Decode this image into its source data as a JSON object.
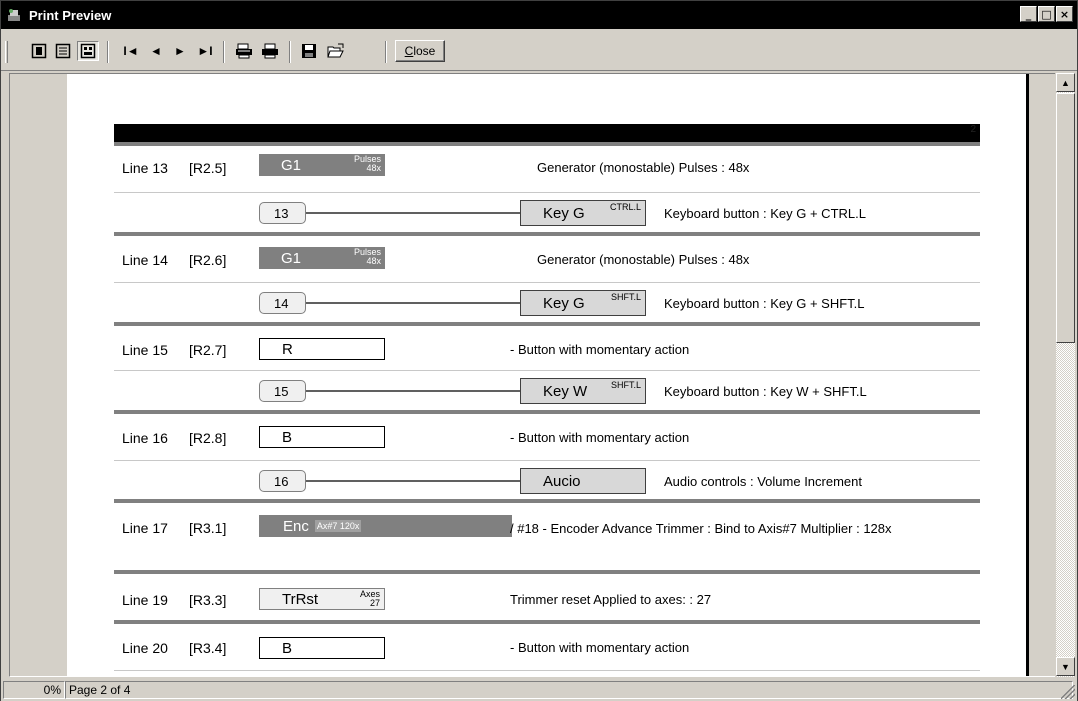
{
  "window": {
    "title": "Print Preview",
    "controls": [
      "_",
      "□",
      "×"
    ]
  },
  "toolbar": {
    "buttons": [
      {
        "name": "single-page-icon"
      },
      {
        "name": "two-page-icon"
      },
      {
        "name": "multi-page-icon"
      },
      {
        "name": "first-page-icon",
        "glyph": "I◄"
      },
      {
        "name": "prev-page-icon",
        "glyph": "◄"
      },
      {
        "name": "next-page-icon",
        "glyph": "►"
      },
      {
        "name": "last-page-icon",
        "glyph": "►I"
      },
      {
        "name": "print-setup-icon"
      },
      {
        "name": "print-icon"
      },
      {
        "name": "save-icon"
      },
      {
        "name": "open-icon"
      }
    ],
    "close_label_prefix": "",
    "close_label_u": "C",
    "close_label_rest": "lose"
  },
  "status": {
    "zoom": "0%",
    "page": "Page 2 of 4"
  },
  "document": {
    "header_page_no": "2",
    "rows": [
      {
        "line": "Line 13",
        "ref": "[R2.5]",
        "ctrl": "G1",
        "ctrl_sup1": "Pulses",
        "ctrl_sup2": "48x",
        "desc": "Generator (monostable)   Pulses : 48x",
        "sub": {
          "num": "13",
          "key": "Key G",
          "mod": "CTRL.L",
          "desc": "Keyboard button : Key G + CTRL.L"
        }
      },
      {
        "line": "Line 14",
        "ref": "[R2.6]",
        "ctrl": "G1",
        "ctrl_sup1": "Pulses",
        "ctrl_sup2": "48x",
        "desc": "Generator (monostable)   Pulses : 48x",
        "sub": {
          "num": "14",
          "key": "Key G",
          "mod": "SHFT.L",
          "desc": "Keyboard button : Key G + SHFT.L"
        }
      },
      {
        "line": "Line 15",
        "ref": "[R2.7]",
        "ctrl": "R",
        "desc": "- Button with momentary action",
        "sub": {
          "num": "15",
          "key": "Key W",
          "mod": "SHFT.L",
          "desc": "Keyboard button : Key W + SHFT.L"
        }
      },
      {
        "line": "Line 16",
        "ref": "[R2.8]",
        "ctrl": "B",
        "desc": "- Button with momentary action",
        "sub": {
          "num": "16",
          "key": "Aucio",
          "mod": "",
          "desc": "Audio controls : Volume Increment"
        }
      },
      {
        "line": "Line 17",
        "ref": "[R3.1]",
        "ctrl": "Enc",
        "ctrl_tag": "Ax#7 120x",
        "desc": "/ #18  - Encoder Advance  Trimmer : Bind to Axis#7 Multiplier : 128x"
      },
      {
        "line": "Line 19",
        "ref": "[R3.3]",
        "ctrl": "TrRst",
        "ctrl_sup1": "Axes",
        "ctrl_sup2": "27",
        "desc": "Trimmer reset  Applied to axes: : 27"
      },
      {
        "line": "Line 20",
        "ref": "[R3.4]",
        "ctrl": "B",
        "desc": "- Button with momentary action"
      }
    ]
  }
}
